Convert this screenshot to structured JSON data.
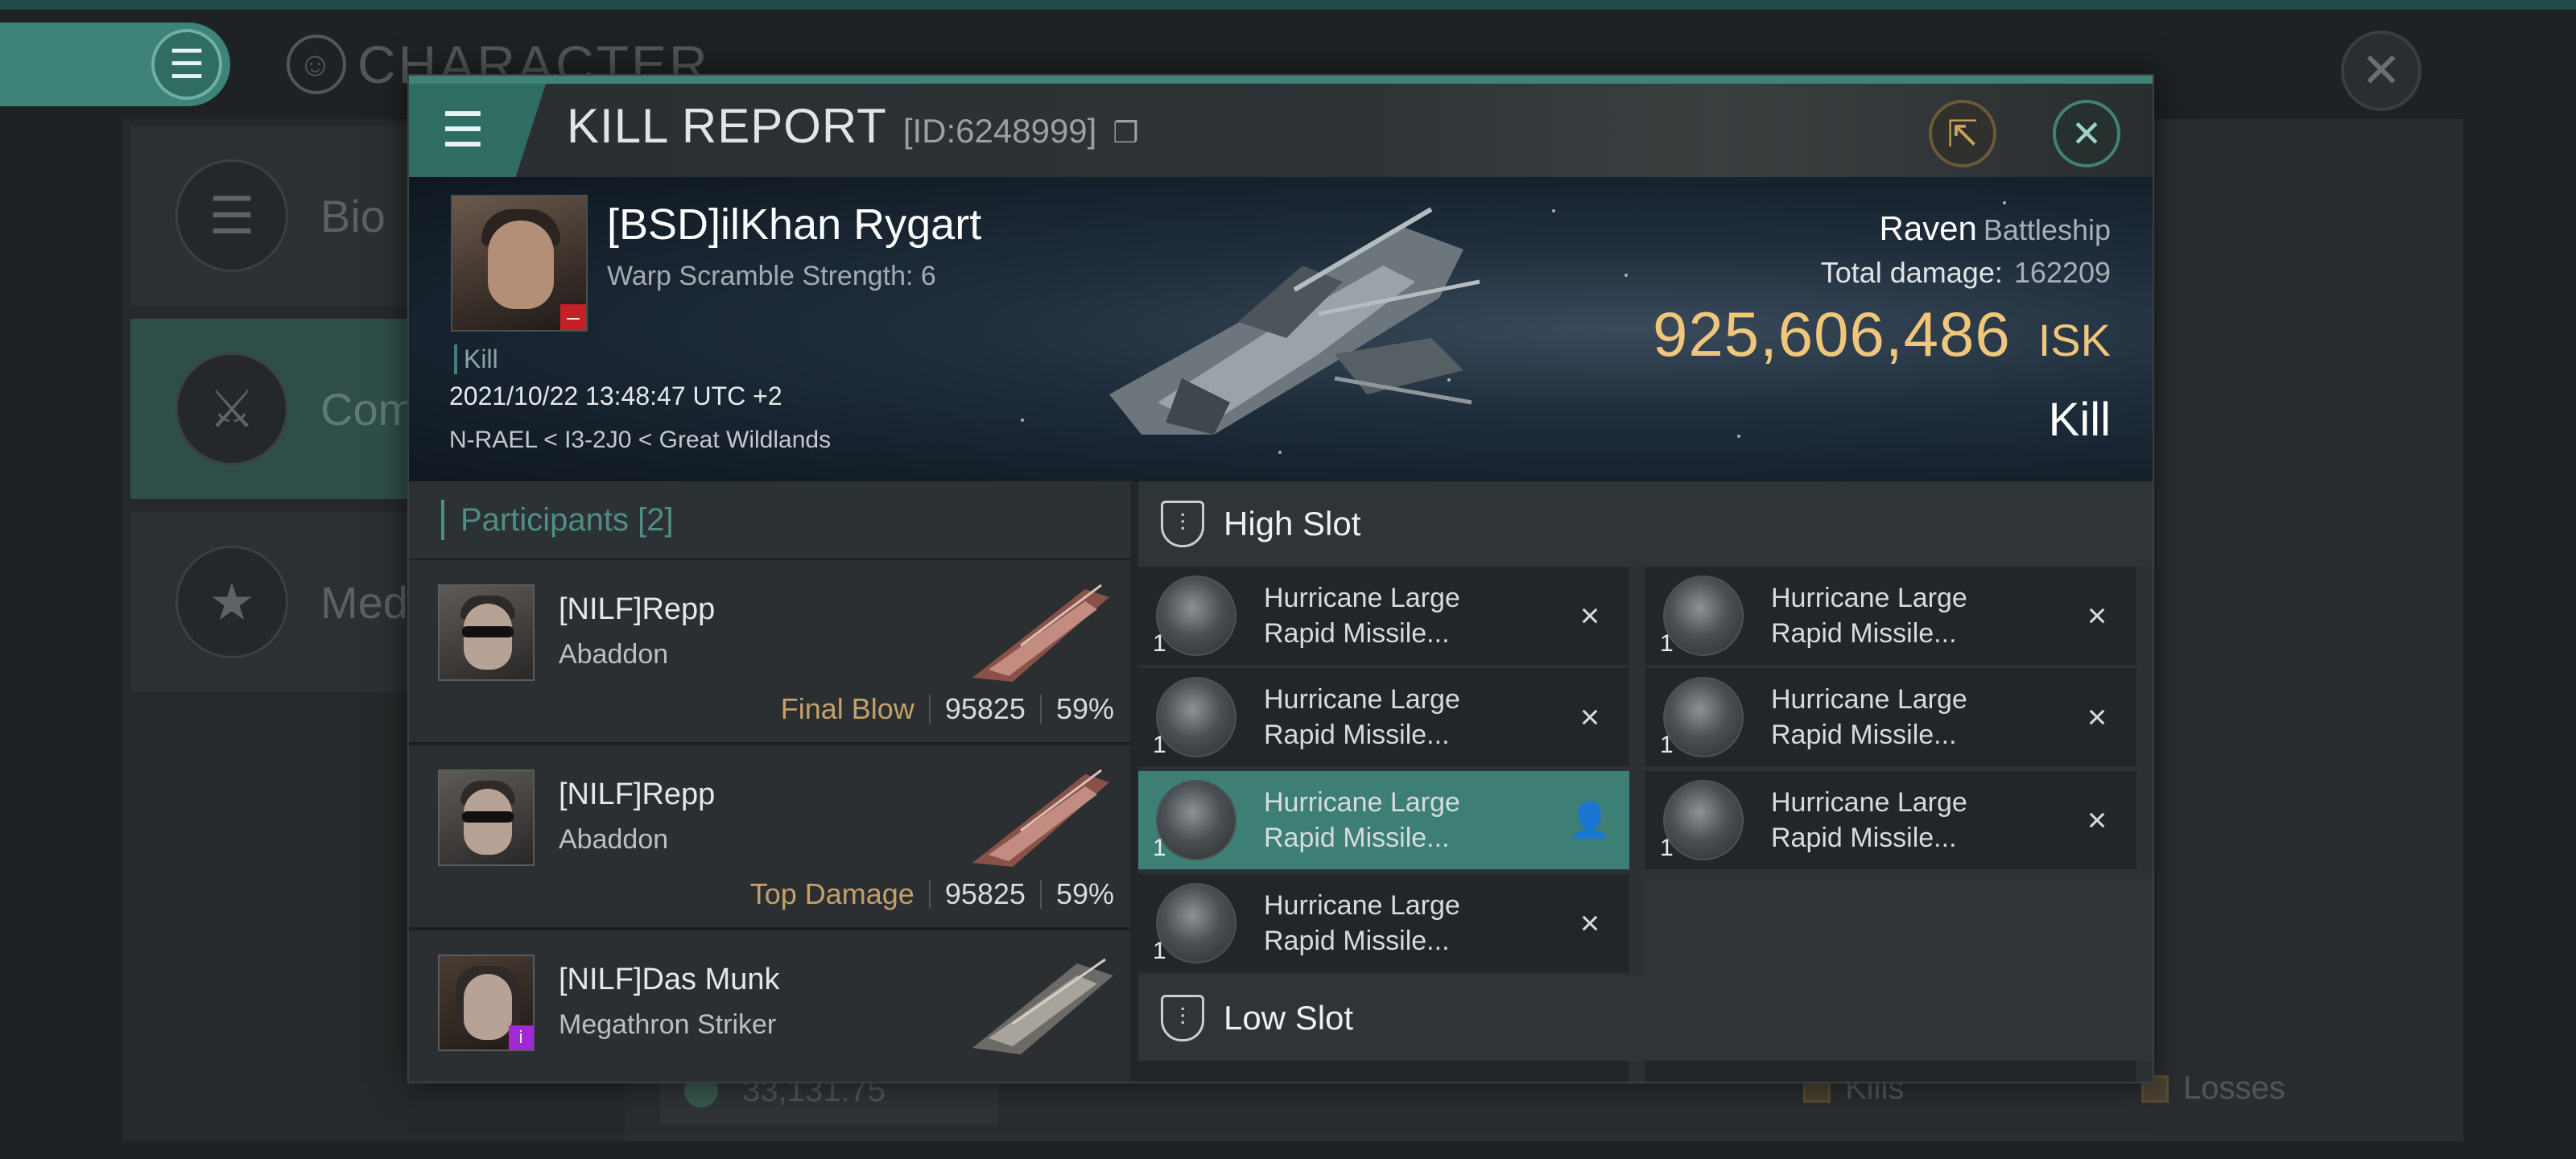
{
  "background": {
    "screen_title": "CHARACTER",
    "sidebar": [
      {
        "label": "Bio",
        "icon": "menu-icon"
      },
      {
        "label": "Comb",
        "icon": "crossed-swords-icon"
      },
      {
        "label": "Meda",
        "icon": "star-badge-icon"
      }
    ],
    "bottom_value": "33,131.75",
    "legend": [
      "Kills",
      "Losses"
    ]
  },
  "modal": {
    "title": "KILL REPORT",
    "report_id": "[ID:6248999]",
    "share_icon": "share-icon",
    "close_icon": "close-icon"
  },
  "victim": {
    "name": "[BSD]ilKhan Rygart",
    "warp_scramble": "Warp Scramble Strength: 6",
    "kind": "Kill",
    "datetime": "2021/10/22 13:48:47 UTC +2",
    "location": "N-RAEL < I3-2J0 < Great Wildlands",
    "ship_name": "Raven",
    "ship_class": "Battleship",
    "total_damage_label": "Total damage:",
    "total_damage": "162209",
    "isk_value": "925,606,486",
    "isk_unit": "ISK",
    "result": "Kill"
  },
  "participants": {
    "label": "Participants",
    "count": "[2]",
    "rows": [
      {
        "name": "[NILF]Repp",
        "ship": "Abaddon",
        "role": "Final Blow",
        "damage": "95825",
        "percent": "59%"
      },
      {
        "name": "[NILF]Repp",
        "ship": "Abaddon",
        "role": "Top Damage",
        "damage": "95825",
        "percent": "59%"
      },
      {
        "name": "[NILF]Das Munk",
        "ship": "Megathron Striker",
        "role": "",
        "damage": "",
        "percent": ""
      }
    ]
  },
  "high_slot": {
    "label": "High Slot",
    "items": [
      {
        "line1": "Hurricane Large",
        "line2": "Rapid Missile...",
        "qty": "1",
        "action": "×"
      },
      {
        "line1": "Hurricane Large",
        "line2": "Rapid Missile...",
        "qty": "1",
        "action": "×"
      },
      {
        "line1": "Hurricane Large",
        "line2": "Rapid Missile...",
        "qty": "1",
        "action": "×"
      },
      {
        "line1": "Hurricane Large",
        "line2": "Rapid Missile...",
        "qty": "1",
        "action": "×"
      },
      {
        "line1": "Hurricane Large",
        "line2": "Rapid Missile...",
        "qty": "1",
        "action": "👤"
      },
      {
        "line1": "Hurricane Large",
        "line2": "Rapid Missile...",
        "qty": "1",
        "action": "×"
      },
      {
        "line1": "Hurricane Large",
        "line2": "Rapid Missile...",
        "qty": "1",
        "action": "×"
      }
    ]
  },
  "low_slot": {
    "label": "Low Slot"
  },
  "colors": {
    "accent_teal": "#3f8277",
    "isk_gold": "#f0c77a",
    "role_gold": "#c4a06a"
  }
}
